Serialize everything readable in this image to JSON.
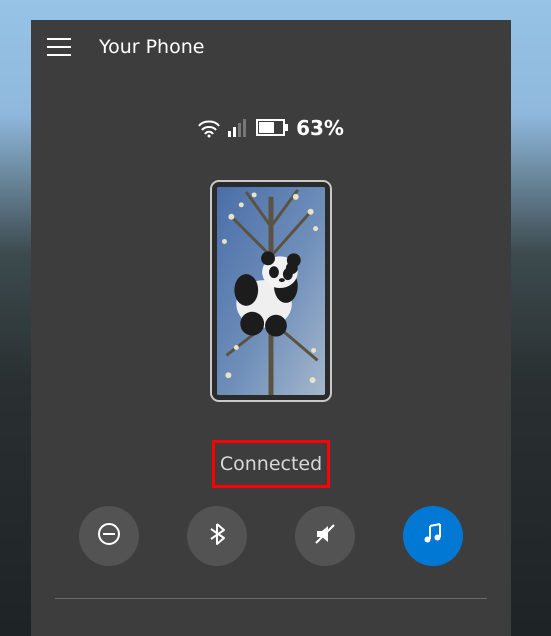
{
  "header": {
    "title": "Your Phone"
  },
  "status_bar": {
    "wifi_icon": "wifi-icon",
    "signal_icon": "signal-icon",
    "battery_icon": "battery-icon",
    "battery_percentage": "63%"
  },
  "phone": {
    "wallpaper_description": "panda-on-branch"
  },
  "connection": {
    "status_label": "Connected",
    "highlight_color": "#ff0000"
  },
  "actions": [
    {
      "name": "dnd-button",
      "icon": "do-not-disturb-icon",
      "accent": false
    },
    {
      "name": "bluetooth-button",
      "icon": "bluetooth-icon",
      "accent": false
    },
    {
      "name": "mute-button",
      "icon": "volume-mute-icon",
      "accent": false
    },
    {
      "name": "music-button",
      "icon": "music-icon",
      "accent": true
    }
  ],
  "colors": {
    "panel_bg": "#3d3d3d",
    "action_bg": "#535353",
    "accent": "#0078d4"
  }
}
